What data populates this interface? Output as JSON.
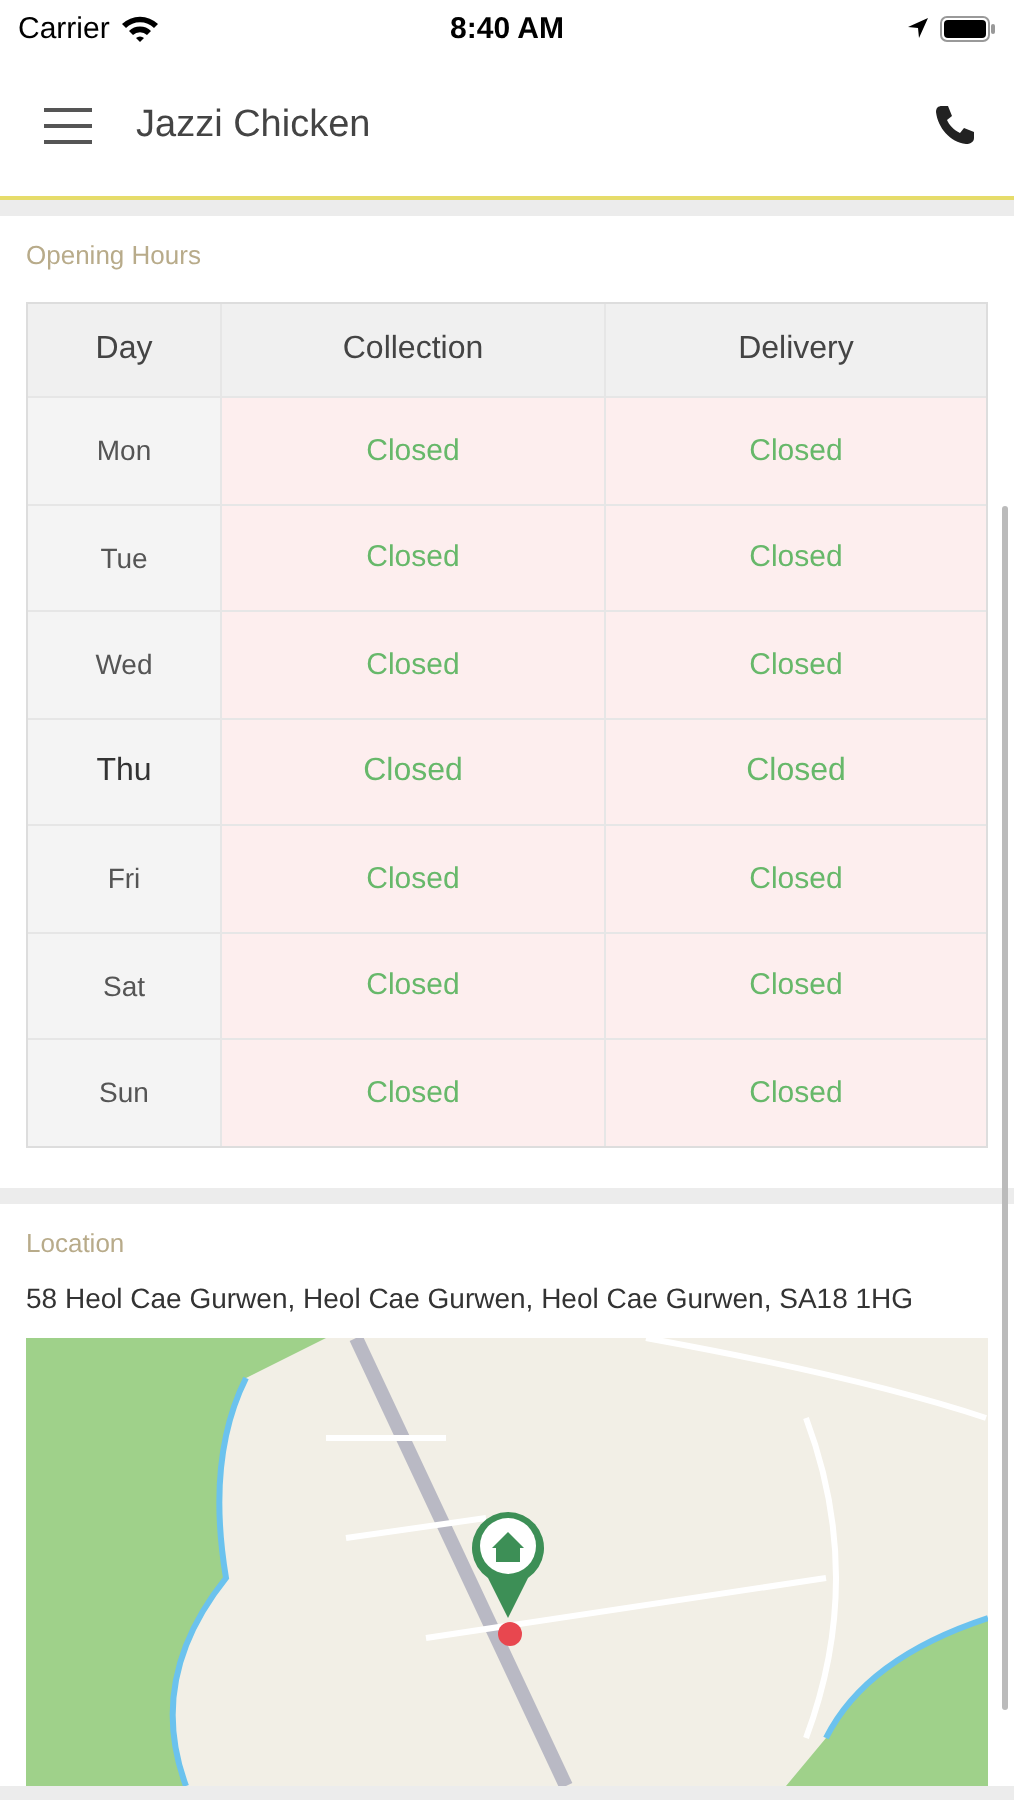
{
  "status_bar": {
    "carrier": "Carrier",
    "time": "8:40 AM"
  },
  "header": {
    "title": "Jazzi Chicken"
  },
  "opening_hours": {
    "title": "Opening Hours",
    "columns": [
      "Day",
      "Collection",
      "Delivery"
    ],
    "rows": [
      {
        "day": "Mon",
        "collection": "Closed",
        "delivery": "Closed",
        "today": false
      },
      {
        "day": "Tue",
        "collection": "Closed",
        "delivery": "Closed",
        "today": false
      },
      {
        "day": "Wed",
        "collection": "Closed",
        "delivery": "Closed",
        "today": false
      },
      {
        "day": "Thu",
        "collection": "Closed",
        "delivery": "Closed",
        "today": true
      },
      {
        "day": "Fri",
        "collection": "Closed",
        "delivery": "Closed",
        "today": false
      },
      {
        "day": "Sat",
        "collection": "Closed",
        "delivery": "Closed",
        "today": false
      },
      {
        "day": "Sun",
        "collection": "Closed",
        "delivery": "Closed",
        "today": false
      }
    ]
  },
  "location": {
    "title": "Location",
    "address": "58 Heol Cae Gurwen, Heol Cae Gurwen, Heol Cae Gurwen, SA18 1HG"
  }
}
